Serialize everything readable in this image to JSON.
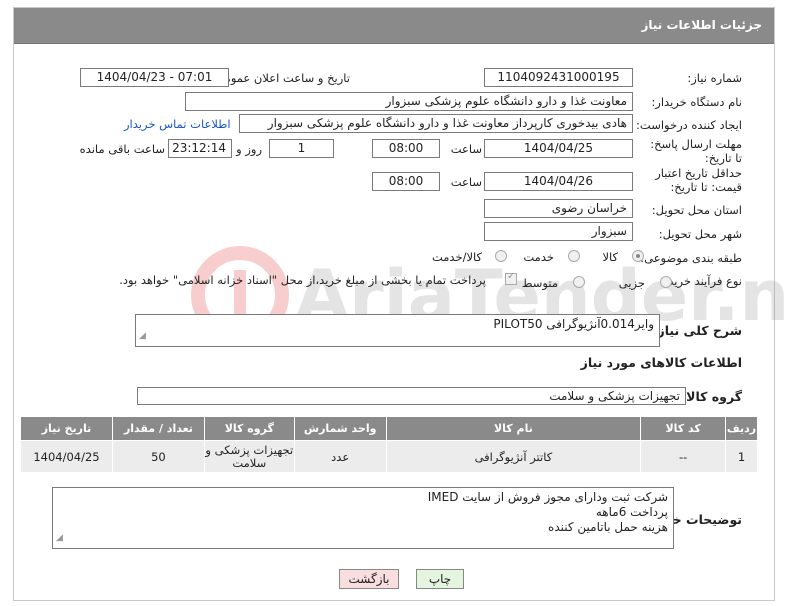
{
  "header": {
    "title": "جزئیات اطلاعات نیاز"
  },
  "labels": {
    "need_number": "شماره نیاز:",
    "announce_datetime": "تاریخ و ساعت اعلان عمومی:",
    "buyer_org": "نام دستگاه خریدار:",
    "requester": "ایجاد کننده درخواست:",
    "reply_deadline": "مهلت ارسال پاسخ: تا تاریخ:",
    "price_validity": "حداقل تاریخ اعتبار قیمت: تا تاریخ:",
    "hour": "ساعت",
    "day_and": "روز و",
    "remaining": "ساعت باقی مانده",
    "province": "استان محل تحویل:",
    "city": "شهر محل تحویل:",
    "category": "طبقه بندی موضوعی:",
    "process_type": "نوع فرآیند خرید :",
    "description": "شرح کلی نیاز:",
    "goods_info": "اطلاعات کالاهای مورد نیاز",
    "goods_group": "گروه کالا:",
    "buyer_notes": "توضیحات خریدار:"
  },
  "values": {
    "need_number": "1104092431000195",
    "announce_datetime": "1404/04/23 - 07:01",
    "buyer_org": "معاونت غذا و دارو   دانشگاه علوم پزشکی سبزوار",
    "requester": "هادی بیدخوری کارپرداز معاونت غذا و دارو   دانشگاه علوم پزشکی سبزوار",
    "contact_link": "اطلاعات تماس خریدار",
    "reply_date": "1404/04/25",
    "reply_hour": "08:00",
    "reply_days": "1",
    "reply_remaining": "23:12:14",
    "validity_date": "1404/04/26",
    "validity_hour": "08:00",
    "province": "خراسان رضوی",
    "city": "سبزوار",
    "description": "وایر0.014آنژیوگرافی PILOT50",
    "goods_group": "تجهیزات پزشکی و سلامت"
  },
  "category_options": [
    "کالا",
    "خدمت",
    "کالا/خدمت"
  ],
  "process_options": [
    "جزیی",
    "متوسط"
  ],
  "payment_note": "پرداخت تمام یا بخشی از مبلغ خرید،از محل \"اسناد خزانه اسلامی\" خواهد بود.",
  "table": {
    "headers": [
      "ردیف",
      "کد کالا",
      "نام کالا",
      "واحد شمارش",
      "گروه کالا",
      "تعداد / مقدار",
      "تاریخ نیاز"
    ],
    "rows": [
      [
        "1",
        "--",
        "کاتتر آنژیوگرافی",
        "عدد",
        "تجهیزات پزشکی و سلامت",
        "50",
        "1404/04/25"
      ]
    ]
  },
  "buyer_notes_lines": [
    "شرکت ثبت ودارای مجوز فروش از سایت IMED",
    "پرداخت 6ماهه",
    "هزینه حمل باتامین کننده"
  ],
  "buttons": {
    "print": "چاپ",
    "back": "بازگشت"
  },
  "watermark_text": "AriaTender.neT",
  "colors": {
    "header": "#8a8a8a",
    "link": "#1a56c4",
    "back_button": "#f8dede",
    "print_button": "#e3f4df"
  }
}
